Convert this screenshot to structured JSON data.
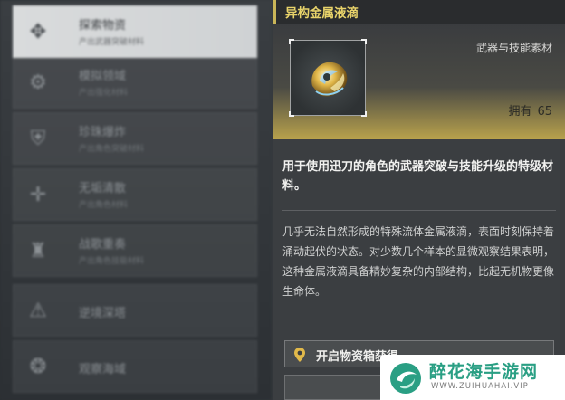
{
  "menu": {
    "items": [
      {
        "title": "探索物资",
        "subtitle": "产出武器突破材料",
        "icon": "crosshair-icon",
        "active": true
      },
      {
        "title": "模拟领域",
        "subtitle": "产出强化材料",
        "icon": "gear-icon",
        "active": false
      },
      {
        "title": "珍珠爆炸",
        "subtitle": "产出角色突破材料",
        "icon": "shield-icon",
        "active": false
      },
      {
        "title": "无垢清散",
        "subtitle": "产出角色材料",
        "icon": "cross-icon",
        "active": false
      },
      {
        "title": "战歌重奏",
        "subtitle": "产出角色技能材料",
        "icon": "tower-icon",
        "active": false
      },
      {
        "title": "逆境深塔",
        "subtitle": "",
        "icon": "warning-icon",
        "active": false
      },
      {
        "title": "观察海域",
        "subtitle": "",
        "icon": "wave-icon",
        "active": false
      }
    ]
  },
  "item": {
    "name": "异构金属液滴",
    "category": "武器与技能素材",
    "owned_label": "拥有",
    "owned_count": "65",
    "usage": "用于使用迅刀的角色的武器突破与技能升级的特级材料。",
    "lore": "几乎无法自然形成的特殊流体金属液滴，表面时刻保持着涌动起伏的状态。对少数几个样本的显微观察结果表明，这种金属液滴具备精妙复杂的内部结构，比起无机物更像生命体。",
    "thumb_icon": "metal-droplet-icon"
  },
  "sources": [
    {
      "label": "开启物资箱获得",
      "icon": "location-pin-icon"
    }
  ],
  "watermark": {
    "title": "醉花海手游网",
    "url": "WWW.ZUIHUAHAI.VIP"
  },
  "colors": {
    "accent_gold": "#e8d36a",
    "watermark_green": "#2a9f84"
  }
}
